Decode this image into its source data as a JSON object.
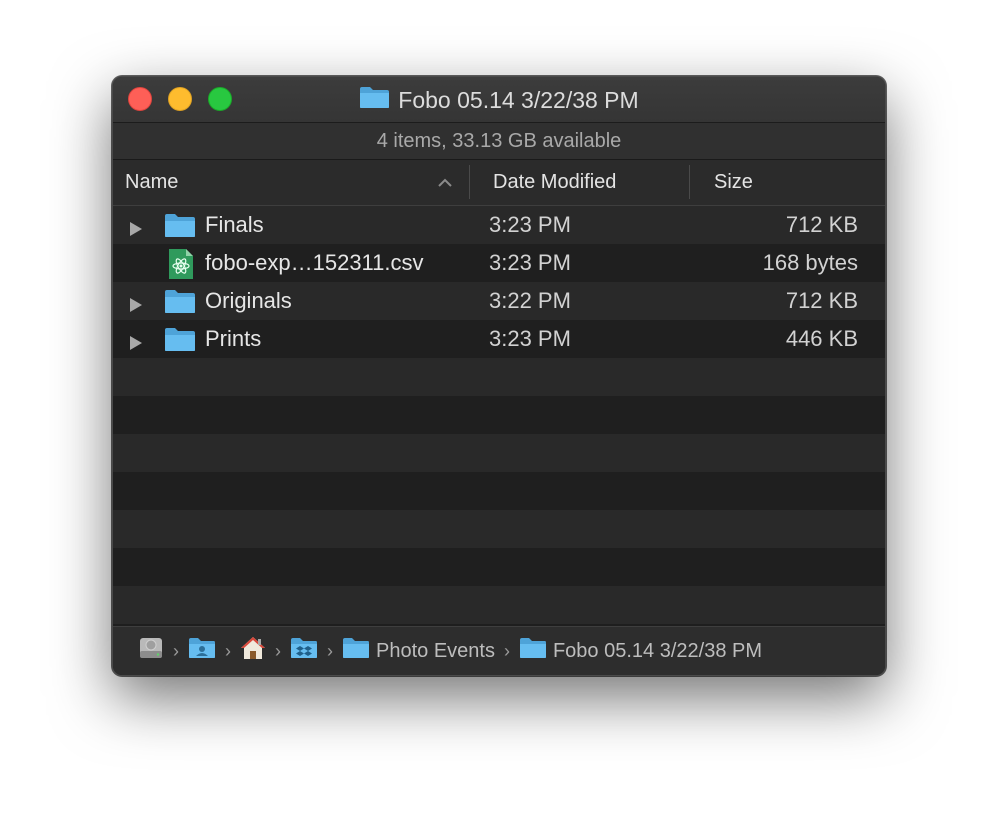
{
  "window": {
    "title": "Fobo 05.14 3/22/38 PM",
    "status": "4 items, 33.13 GB available"
  },
  "columns": {
    "name": "Name",
    "date": "Date Modified",
    "size": "Size"
  },
  "rows": [
    {
      "name": "Finals",
      "date": "3:23 PM",
      "size": "712 KB",
      "kind": "folder",
      "icon": "folder-icon"
    },
    {
      "name": "fobo-exp…152311.csv",
      "date": "3:23 PM",
      "size": "168 bytes",
      "kind": "file",
      "icon": "csv-file-icon"
    },
    {
      "name": "Originals",
      "date": "3:22 PM",
      "size": "712 KB",
      "kind": "folder",
      "icon": "folder-icon"
    },
    {
      "name": "Prints",
      "date": "3:23 PM",
      "size": "446 KB",
      "kind": "folder",
      "icon": "folder-icon"
    }
  ],
  "pathbar": {
    "crumbs": [
      {
        "icon": "hard-drive-icon",
        "label": ""
      },
      {
        "icon": "user-folder-icon",
        "label": ""
      },
      {
        "icon": "home-icon",
        "label": ""
      },
      {
        "icon": "dropbox-folder-icon",
        "label": ""
      },
      {
        "icon": "folder-icon",
        "label": "Photo Events"
      },
      {
        "icon": "folder-icon",
        "label": "Fobo 05.14 3/22/38 PM"
      }
    ]
  },
  "colors": {
    "window_bg": "#1e1e1e",
    "row_alt": "#292929",
    "folder_blue": "#5fb7ec",
    "close": "#fe5f57",
    "minimize": "#febc2e",
    "zoom": "#28c840"
  }
}
